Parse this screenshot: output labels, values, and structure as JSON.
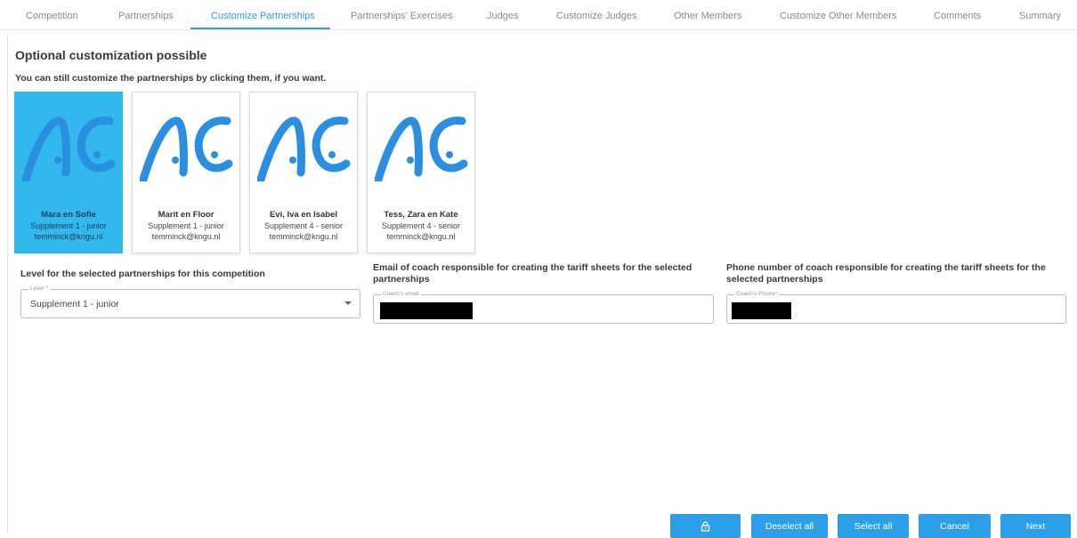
{
  "tabs": [
    {
      "label": "Competition"
    },
    {
      "label": "Partnerships"
    },
    {
      "label": "Customize Partnerships"
    },
    {
      "label": "Partnerships' Exercises"
    },
    {
      "label": "Judges"
    },
    {
      "label": "Customize Judges"
    },
    {
      "label": "Other Members"
    },
    {
      "label": "Customize Other Members"
    },
    {
      "label": "Comments"
    },
    {
      "label": "Summary"
    }
  ],
  "active_tab": "Customize Partnerships",
  "page": {
    "title": "Optional customization possible",
    "subtitle": "You can still customize the partnerships by clicking them, if you want."
  },
  "partnerships": [
    {
      "name": "Mara en Sofie",
      "level": "Supplement 1 - junior",
      "email": "temminck@kngu.nl",
      "selected": true
    },
    {
      "name": "Marit en Floor",
      "level": "Supplement 1 - junior",
      "email": "temminck@kngu.nl",
      "selected": false
    },
    {
      "name": "Evi, Iva en Isabel",
      "level": "Supplement 4 - senior",
      "email": "temminck@kngu.nl",
      "selected": false
    },
    {
      "name": "Tess, Zara en Kate",
      "level": "Supplement 4 - senior",
      "email": "temminck@kngu.nl",
      "selected": false
    }
  ],
  "level_section": {
    "heading": "Level for the selected partnerships for this competition",
    "legend": "Level *",
    "value": "Supplement 1 - junior"
  },
  "email_section": {
    "heading": "Email of coach responsible for creating the tariff sheets for the selected partnerships",
    "legend": "Coach's email"
  },
  "phone_section": {
    "heading": "Phone number of coach responsible for creating the tariff sheets for the selected partnerships",
    "legend": "Coach's Phone*"
  },
  "buttons": {
    "lock_icon": "lock-icon",
    "deselect_all": "Deselect all",
    "select_all": "Select all",
    "cancel": "Cancel",
    "next": "Next"
  },
  "colors": {
    "accent": "#2d9ee8",
    "selected_card": "#33b8ee",
    "logo": "#2a8fe0"
  }
}
